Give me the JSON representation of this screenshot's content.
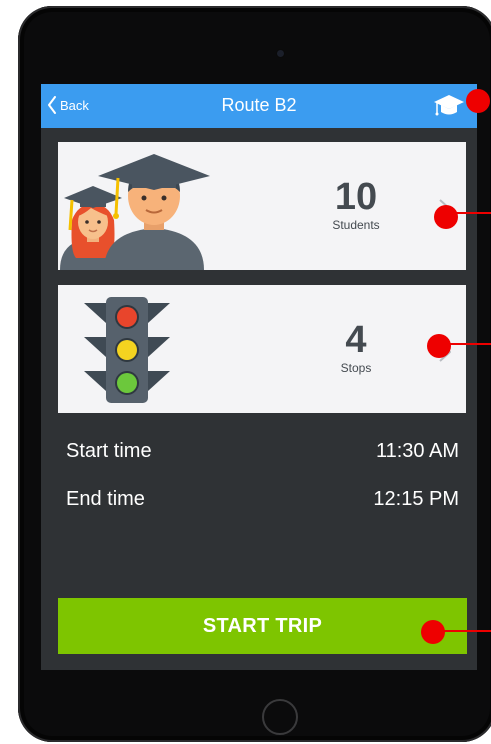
{
  "nav": {
    "back_label": "Back",
    "title": "Route B2",
    "accent_color": "#3b9cf0"
  },
  "students_card": {
    "count": "10",
    "label": "Students"
  },
  "stops_card": {
    "count": "4",
    "label": "Stops"
  },
  "times": {
    "start_label": "Start time",
    "start_value": "11:30 AM",
    "end_label": "End time",
    "end_value": "12:15 PM"
  },
  "start_button": {
    "label": "START TRIP",
    "color": "#7ec500"
  },
  "annotation_marker_color": "#ee0000"
}
